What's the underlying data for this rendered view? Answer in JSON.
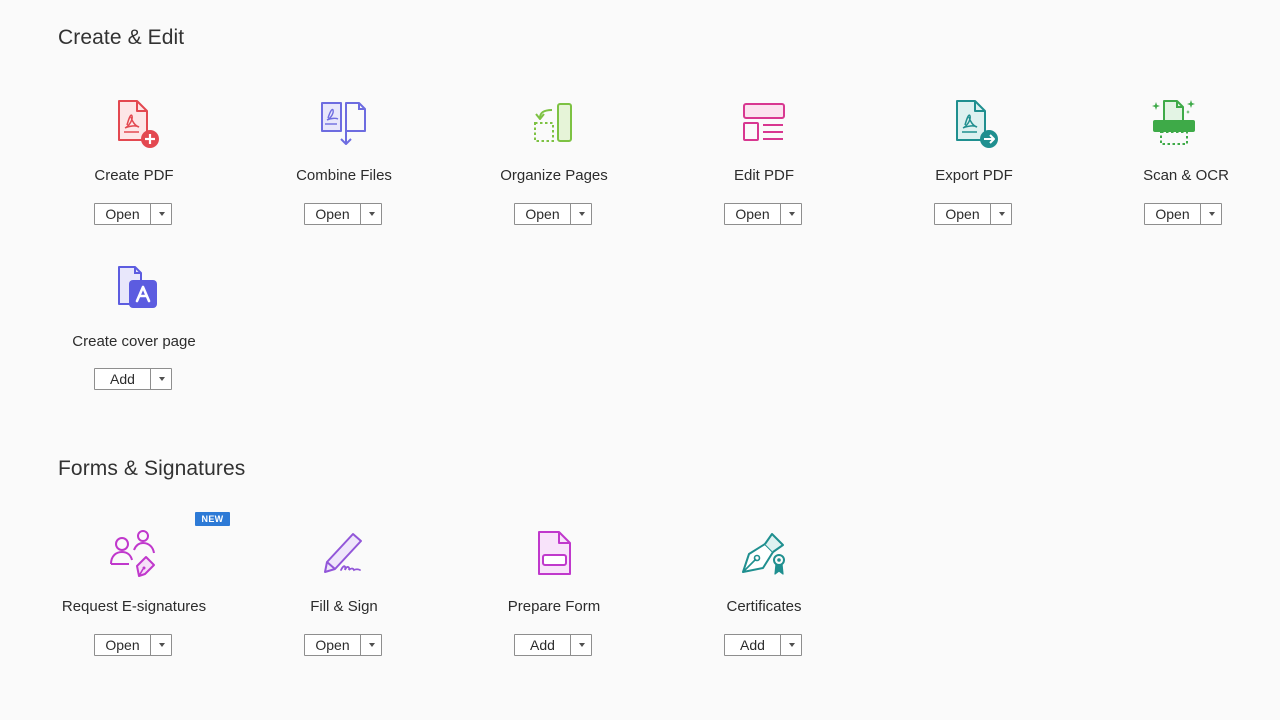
{
  "sections": [
    {
      "title": "Create & Edit",
      "tools": [
        {
          "label": "Create PDF",
          "button": "Open",
          "icon": "create-pdf-icon",
          "color": "#e34850"
        },
        {
          "label": "Combine Files",
          "button": "Open",
          "icon": "combine-files-icon",
          "color": "#6d6ce0"
        },
        {
          "label": "Organize Pages",
          "button": "Open",
          "icon": "organize-pages-icon",
          "color": "#7dc243"
        },
        {
          "label": "Edit PDF",
          "button": "Open",
          "icon": "edit-pdf-icon",
          "color": "#d83790"
        },
        {
          "label": "Export PDF",
          "button": "Open",
          "icon": "export-pdf-icon",
          "color": "#1f8f8f"
        },
        {
          "label": "Scan & OCR",
          "button": "Open",
          "icon": "scan-ocr-icon",
          "color": "#3eaa48"
        },
        {
          "label": "Create cover page",
          "button": "Add",
          "icon": "create-cover-page-icon",
          "color": "#5c5ce0"
        }
      ]
    },
    {
      "title": "Forms & Signatures",
      "tools": [
        {
          "label": "Request E-signatures",
          "button": "Open",
          "icon": "request-esignatures-icon",
          "color": "#c038cc",
          "badge": "NEW"
        },
        {
          "label": "Fill & Sign",
          "button": "Open",
          "icon": "fill-sign-icon",
          "color": "#9256d9"
        },
        {
          "label": "Prepare Form",
          "button": "Add",
          "icon": "prepare-form-icon",
          "color": "#c038cc"
        },
        {
          "label": "Certificates",
          "button": "Add",
          "icon": "certificates-icon",
          "color": "#1f8f8f"
        }
      ]
    }
  ]
}
